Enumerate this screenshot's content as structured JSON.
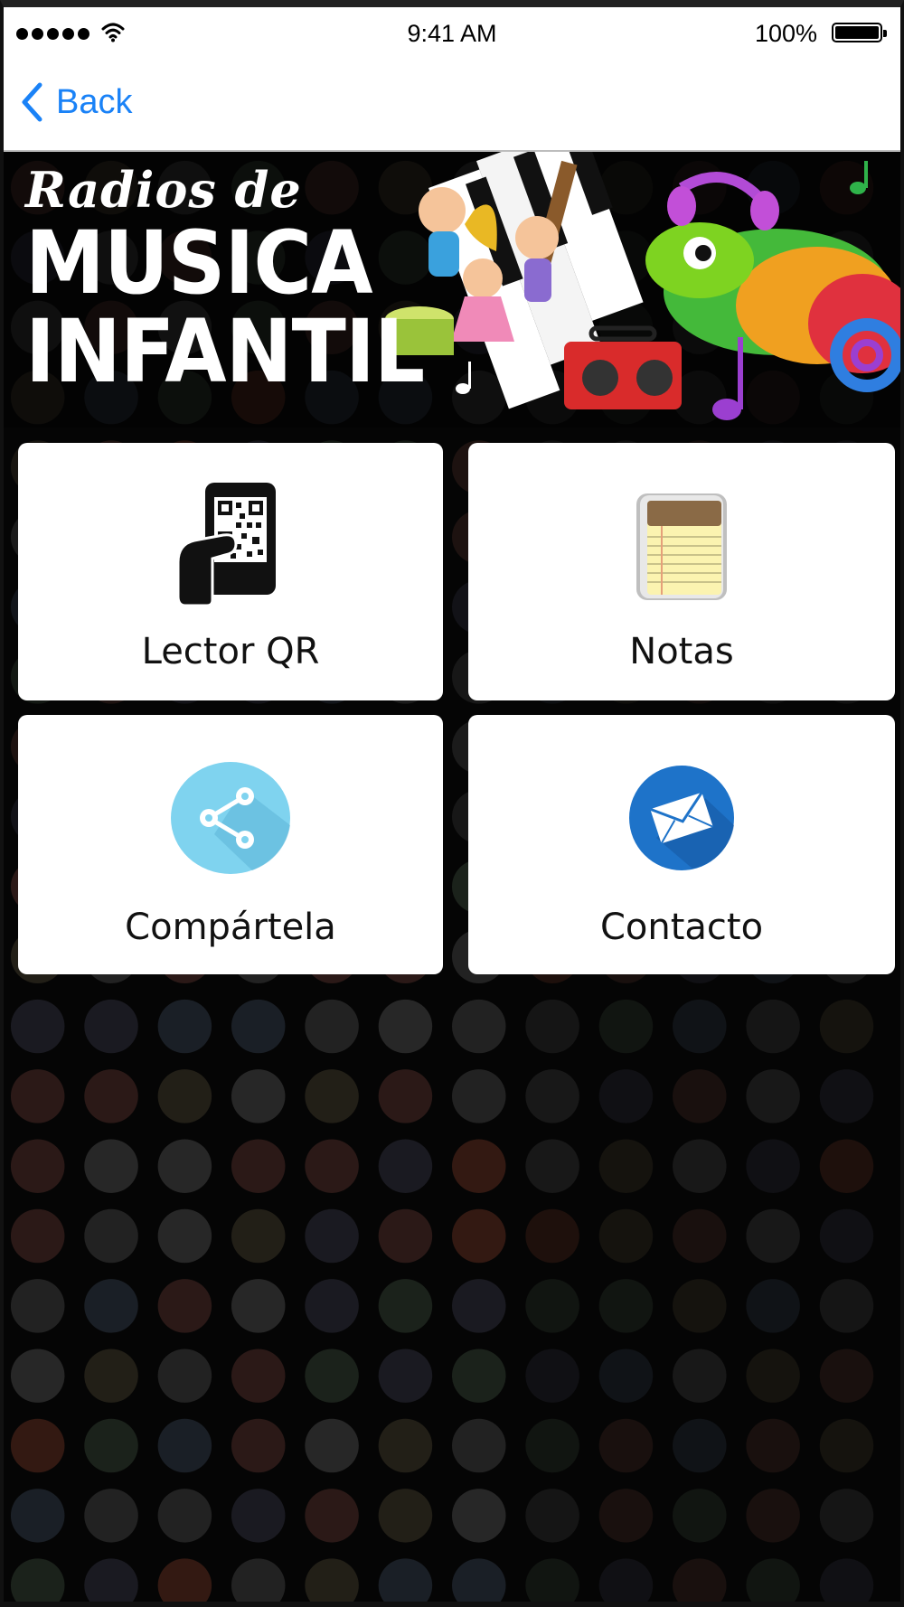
{
  "status_bar": {
    "time": "9:41 AM",
    "battery": "100%"
  },
  "nav": {
    "back_label": "Back"
  },
  "banner": {
    "line1": "Radios de",
    "line2": "MUSICA",
    "line3": "INFANTIL"
  },
  "tiles": [
    {
      "label": "Lector QR",
      "icon": "qr-scanner-icon"
    },
    {
      "label": "Notas",
      "icon": "notepad-icon"
    },
    {
      "label": "Compártela",
      "icon": "share-icon"
    },
    {
      "label": "Contacto",
      "icon": "mail-icon"
    }
  ],
  "colors": {
    "accent": "#1a82f7",
    "share_icon_bg": "#7fd3ef",
    "mail_icon_bg": "#1e73c9"
  }
}
